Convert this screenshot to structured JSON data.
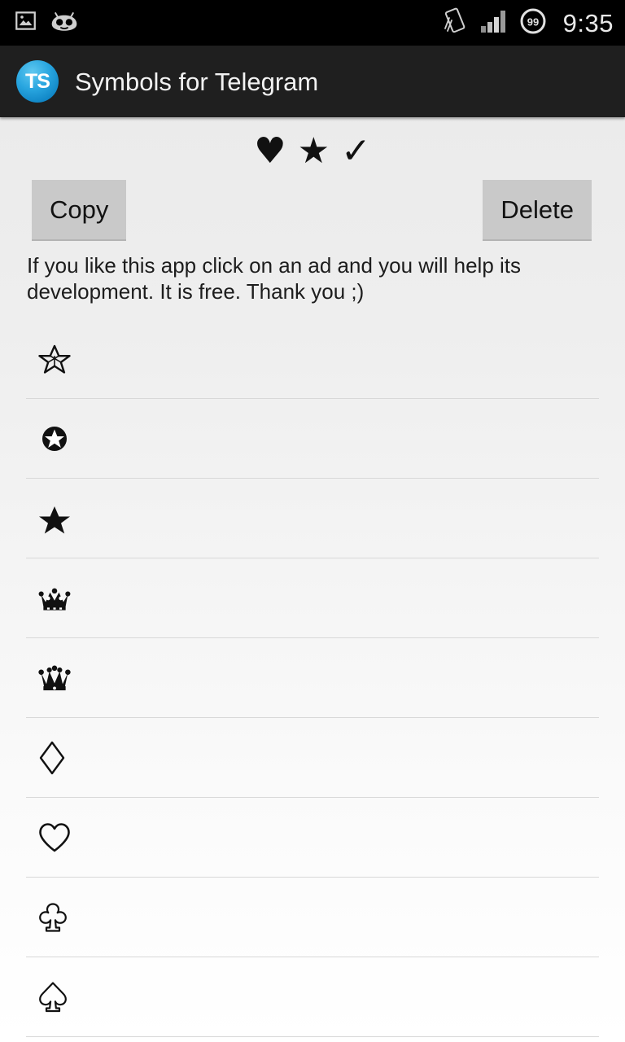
{
  "status_bar": {
    "left_icons": [
      {
        "name": "gallery-icon",
        "label": "Gallery"
      },
      {
        "name": "cyanogenmod-icon",
        "label": "CyanogenMod"
      }
    ],
    "right_icons": [
      {
        "name": "screen-rotation-icon",
        "label": "Screen rotation"
      },
      {
        "name": "signal-bars-icon",
        "label": "Signal strength"
      },
      {
        "name": "battery-icon",
        "label": "Battery",
        "value": "99"
      }
    ],
    "clock": "9:35",
    "background_color": "#000000",
    "text_color": "#e8e8e8"
  },
  "app_bar": {
    "icon_text": "TS",
    "icon_color": "#29a6e0",
    "title": "Symbols for Telegram",
    "background_color": "#1f1f1f",
    "title_color": "#f2f2f2"
  },
  "preview": {
    "symbols": [
      "♥",
      "★",
      "✓"
    ]
  },
  "toolbar": {
    "copy_label": "Copy",
    "delete_label": "Delete",
    "button_color": "#c9c9c9"
  },
  "hint": {
    "text": "If you like this app click on an ad and you will help its development. It is free. Thank you ;)"
  },
  "symbol_list": {
    "items": [
      {
        "glyph": "✫",
        "name": "outlined-pentagram-star"
      },
      {
        "glyph": "✪",
        "name": "circled-star"
      },
      {
        "glyph": "★",
        "name": "filled-star"
      },
      {
        "glyph": "♛",
        "name": "white-crown"
      },
      {
        "glyph": "♛",
        "name": "black-chess-queen"
      },
      {
        "glyph": "♢",
        "name": "outlined-diamond"
      },
      {
        "glyph": "♡",
        "name": "outlined-heart"
      },
      {
        "glyph": "♧",
        "name": "outlined-club"
      },
      {
        "glyph": "♤",
        "name": "outlined-spade"
      }
    ]
  }
}
